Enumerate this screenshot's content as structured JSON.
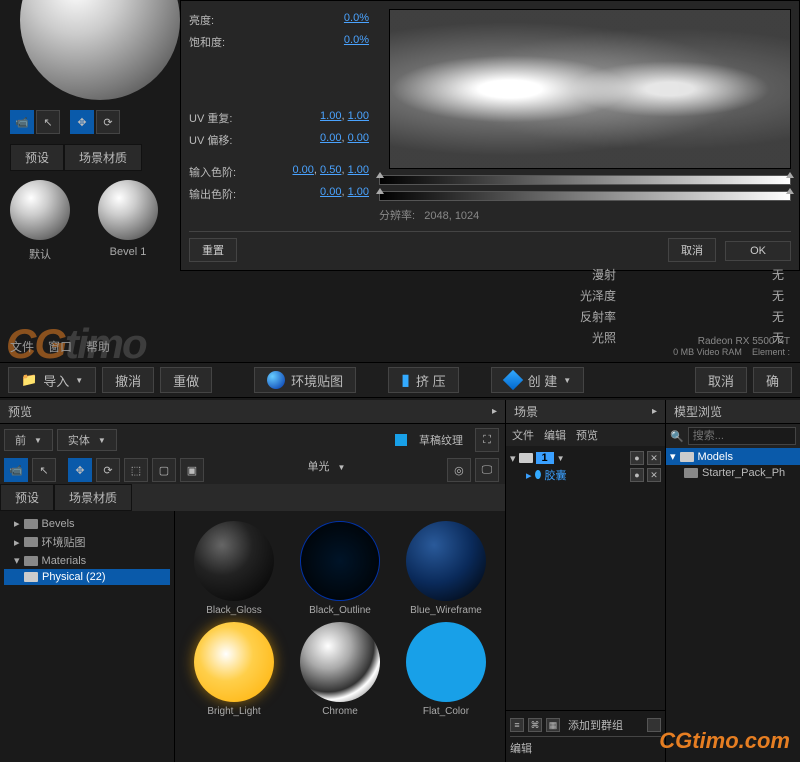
{
  "dialog": {
    "brightness_label": "亮度:",
    "brightness_val": "0.0%",
    "saturation_label": "饱和度:",
    "saturation_val": "0.0%",
    "uv_repeat_label": "UV 重复:",
    "uv_repeat_v1": "1.00",
    "uv_repeat_v2": "1.00",
    "uv_offset_label": "UV 偏移:",
    "uv_offset_v1": "0.00",
    "uv_offset_v2": "0.00",
    "input_levels_label": "输入色阶:",
    "input_levels_v1": "0.00",
    "input_levels_v2": "0.50",
    "input_levels_v3": "1.00",
    "output_levels_label": "输出色阶:",
    "output_levels_v1": "0.00",
    "output_levels_v2": "1.00",
    "resolution_label": "分辨率:",
    "resolution_val": "2048, 1024",
    "reset": "重置",
    "cancel": "取消",
    "ok": "OK"
  },
  "top_tabs": {
    "presets": "预设",
    "scene_mat": "场景材质"
  },
  "presets": {
    "default": "默认",
    "bevel1": "Bevel 1"
  },
  "channels": {
    "diffuse": "漫射",
    "gloss": "光泽度",
    "reflect": "反射率",
    "illum": "光照",
    "none": "无"
  },
  "menu": {
    "file": "文件",
    "window": "窗口",
    "help": "帮助"
  },
  "gpu": {
    "name": "Radeon RX 5500 XT",
    "ram": "0 MB Video RAM",
    "element": "Element"
  },
  "toolbar": {
    "import": "导入",
    "undo": "撤消",
    "redo": "重做",
    "env_map": "环境贴图",
    "extrude": "挤 压",
    "create": "创 建",
    "cancel": "取消",
    "ok": "确"
  },
  "panes": {
    "preview": "预览",
    "scene": "场景",
    "model_browser": "模型浏览",
    "front": "前",
    "solid": "实体",
    "draft_texture": "草稿纹理",
    "single_light": "单光",
    "file": "文件",
    "edit": "编辑",
    "preview2": "预览",
    "search_placeholder": "搜索..."
  },
  "tree": {
    "bevels": "Bevels",
    "envmaps": "环境贴图",
    "materials": "Materials",
    "physical": "Physical (22)"
  },
  "materials": [
    "Black_Gloss",
    "Black_Outline",
    "Blue_Wireframe",
    "Bright_Light",
    "Chrome",
    "Flat_Color"
  ],
  "scene_tree": {
    "root_num": "1",
    "capsule": "胶囊"
  },
  "scene_bottom": {
    "add_to_group": "添加到群组",
    "edit": "编辑"
  },
  "models": {
    "header": "Models",
    "starter": "Starter_Pack_Ph"
  },
  "watermark": {
    "cg": "CG",
    "timo": "timo",
    "dotcom": ".com"
  }
}
